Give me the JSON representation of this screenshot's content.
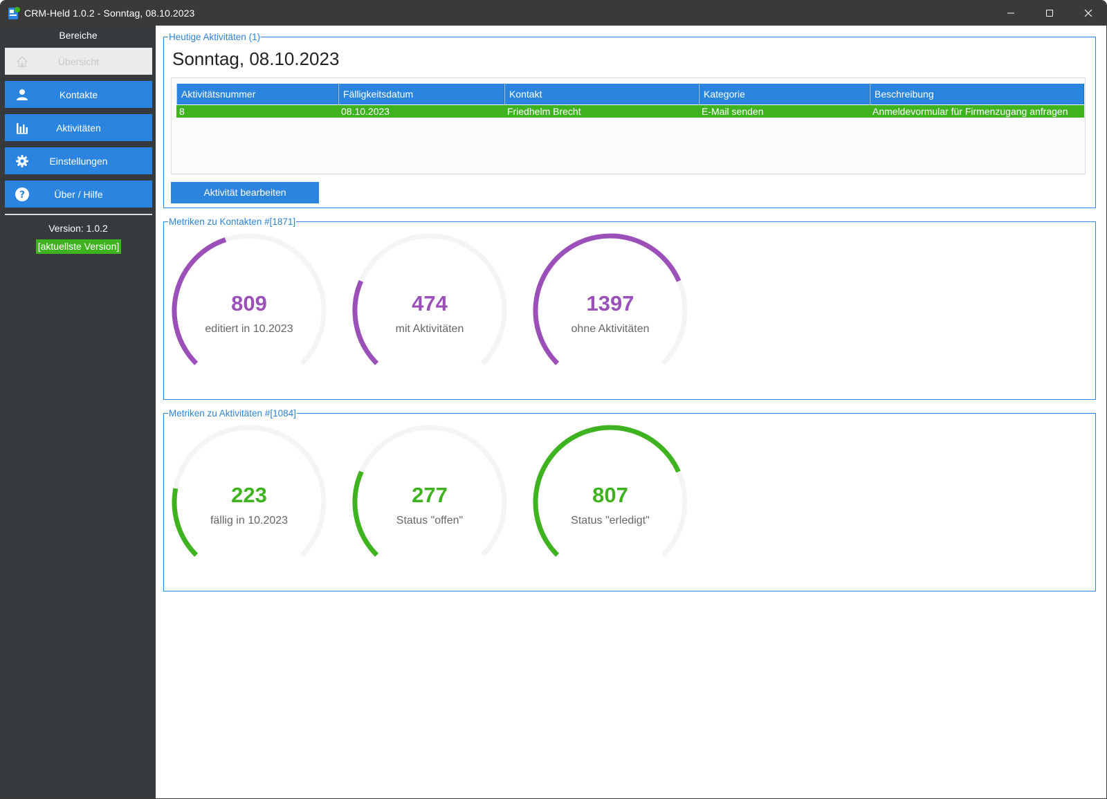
{
  "window": {
    "title": "CRM-Held 1.0.2 - Sonntag, 08.10.2023"
  },
  "sidebar": {
    "header": "Bereiche",
    "items": [
      {
        "label": "Übersicht",
        "icon": "home-icon",
        "active": true
      },
      {
        "label": "Kontakte",
        "icon": "person-icon",
        "active": false
      },
      {
        "label": "Aktivitäten",
        "icon": "chart-icon",
        "active": false
      },
      {
        "label": "Einstellungen",
        "icon": "gear-icon",
        "active": false
      },
      {
        "label": "Über / Hilfe",
        "icon": "help-icon",
        "active": false
      }
    ],
    "version": "Version: 1.0.2",
    "version_status": "[aktuellste Version]"
  },
  "today": {
    "group_title": "Heutige Aktivitäten (1)",
    "date_heading": "Sonntag, 08.10.2023",
    "columns": [
      "Aktivitätsnummer",
      "Fälligkeitsdatum",
      "Kontakt",
      "Kategorie",
      "Beschreibung"
    ],
    "rows": [
      [
        "8",
        "08.10.2023",
        "Friedhelm Brecht",
        "E-Mail senden",
        "Anmeldevormular für Firmenzugang anfragen"
      ]
    ],
    "edit_button": "Aktivität bearbeiten"
  },
  "contact_metrics": {
    "group_title": "Metriken zu Kontakten #[1871]",
    "gauges": [
      {
        "value": "809",
        "label": "editiert in 10.2023",
        "fraction": 0.432
      },
      {
        "value": "474",
        "label": "mit Aktivitäten",
        "fraction": 0.253
      },
      {
        "value": "1397",
        "label": "ohne Aktivitäten",
        "fraction": 0.747
      }
    ]
  },
  "activity_metrics": {
    "group_title": "Metriken zu Aktivitäten #[1084]",
    "gauges": [
      {
        "value": "223",
        "label": "fällig in 10.2023",
        "fraction": 0.206
      },
      {
        "value": "277",
        "label": "Status \"offen\"",
        "fraction": 0.256
      },
      {
        "value": "807",
        "label": "Status \"erledigt\"",
        "fraction": 0.744
      }
    ]
  },
  "colors": {
    "accent_blue": "#2a84e0",
    "sidebar_bg": "#363a3d",
    "status_green": "#3fb31f",
    "gauge_purple": "#9b4fb8",
    "gauge_track": "#f3f4f5"
  }
}
